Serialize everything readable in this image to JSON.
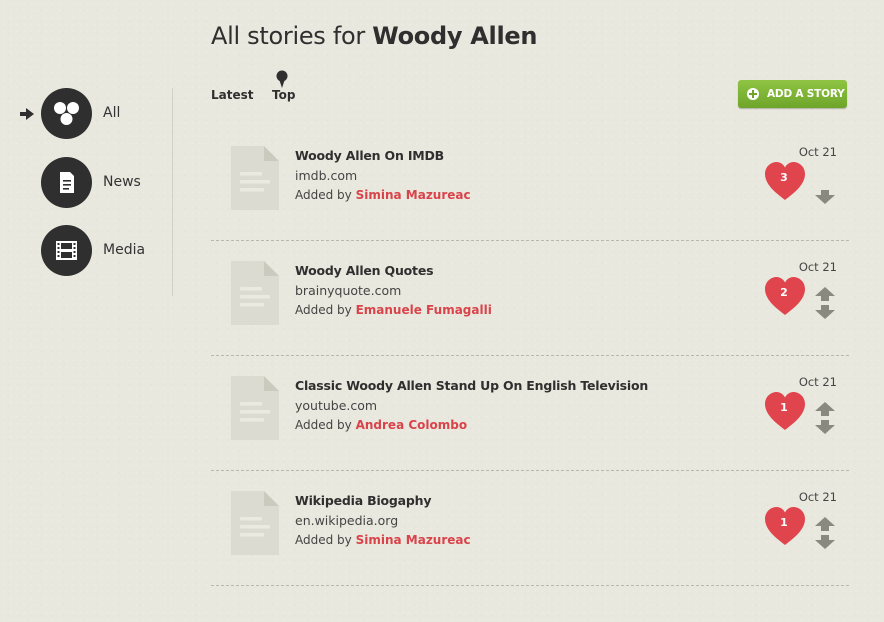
{
  "header": {
    "title_prefix": "All stories for",
    "title_name": "Woody Allen"
  },
  "sidebar": {
    "items": [
      {
        "label": "All",
        "icon": "three-circles-icon",
        "active": true
      },
      {
        "label": "News",
        "icon": "document-icon",
        "active": false
      },
      {
        "label": "Media",
        "icon": "film-icon",
        "active": false
      }
    ]
  },
  "tabs": [
    {
      "label": "Latest",
      "active": false
    },
    {
      "label": "Top",
      "active": true
    }
  ],
  "add_button": {
    "label": "ADD A STORY",
    "icon": "plus-icon",
    "color": "#7cb533"
  },
  "stories": [
    {
      "title": "Woody Allen On IMDB",
      "domain": "imdb.com",
      "added_prefix": "Added by",
      "author": "Simina Mazureac",
      "date": "Oct 21",
      "likes": "3",
      "can_upvote": false
    },
    {
      "title": "Woody Allen Quotes",
      "domain": "brainyquote.com",
      "added_prefix": "Added by",
      "author": "Emanuele Fumagalli",
      "date": "Oct 21",
      "likes": "2",
      "can_upvote": true
    },
    {
      "title": "Classic Woody Allen Stand Up On English Television",
      "domain": "youtube.com",
      "added_prefix": "Added by",
      "author": "Andrea Colombo",
      "date": "Oct 21",
      "likes": "1",
      "can_upvote": true
    },
    {
      "title": "Wikipedia Biogaphy",
      "domain": "en.wikipedia.org",
      "added_prefix": "Added by",
      "author": "Simina Mazureac",
      "date": "Oct 21",
      "likes": "1",
      "can_upvote": true
    }
  ],
  "colors": {
    "accent": "#d9434a",
    "heart": "#e0444d",
    "background": "#e9e8de",
    "dark": "#2f2f2f"
  }
}
